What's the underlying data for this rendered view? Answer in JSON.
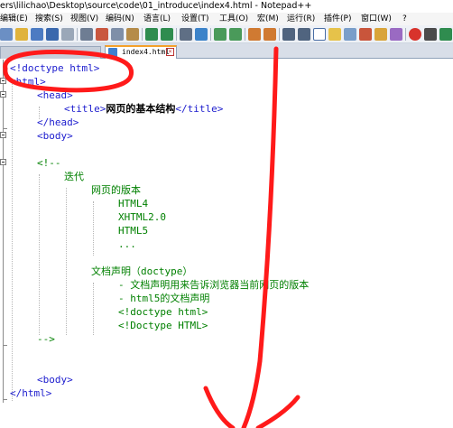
{
  "window": {
    "title": "ers\\lilichao\\Desktop\\source\\code\\01_introduce\\index4.html - Notepad++"
  },
  "menu": [
    {
      "label": "编辑(E)"
    },
    {
      "label": "搜索(S)"
    },
    {
      "label": "视图(V)"
    },
    {
      "label": "编码(N)"
    },
    {
      "label": "语言(L)"
    },
    {
      "label": "设置(T)"
    },
    {
      "label": "工具(O)"
    },
    {
      "label": "宏(M)"
    },
    {
      "label": "运行(R)"
    },
    {
      "label": "插件(P)"
    },
    {
      "label": "窗口(W)"
    },
    {
      "label": "?"
    }
  ],
  "tabs": {
    "active_label": "index4.html"
  },
  "code": {
    "l1": "<!doctype html>",
    "l2": "<html>",
    "l3": "<head>",
    "l4_open": "<title>",
    "l4_text": "网页的基本结构",
    "l4_close": "</title>",
    "l5": "</head>",
    "l6": "<body>",
    "l8": "<!--",
    "l9": "迭代",
    "l10": "网页的版本",
    "l11": "HTML4",
    "l12": "XHTML2.0",
    "l13": "HTML5",
    "l14": "...",
    "l16": "文档声明（doctype）",
    "l17": "- 文档声明用来告诉浏览器当前网页的版本",
    "l18": "- html5的文档声明",
    "l19": "<!doctype html>",
    "l20": "<!Doctype HTML>",
    "l21": "-->",
    "l24": "<body>",
    "l25": "</html>"
  },
  "colors": {
    "tag": "#1c1cce",
    "comment": "#008000",
    "annotation": "#ff0000"
  }
}
